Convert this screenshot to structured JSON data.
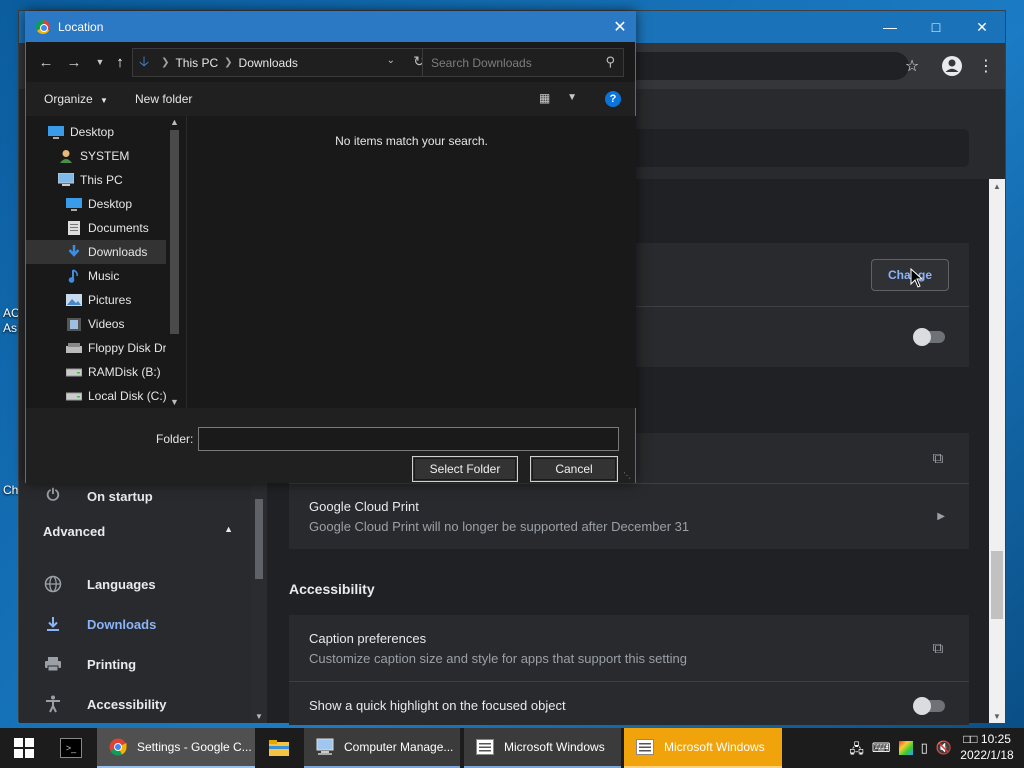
{
  "desktop": {
    "label_1": "AC",
    "label_2": "As",
    "label_3": "Ch"
  },
  "settings": {
    "sidebar": {
      "on_startup": "On startup",
      "advanced": "Advanced",
      "items": [
        {
          "label": "Languages",
          "icon": "globe-icon"
        },
        {
          "label": "Downloads",
          "icon": "download-icon"
        },
        {
          "label": "Printing",
          "icon": "printer-icon"
        },
        {
          "label": "Accessibility",
          "icon": "accessibility-icon"
        }
      ]
    },
    "change_button": "Change",
    "cloud_print_title": "Google Cloud Print",
    "cloud_print_sub": "Google Cloud Print will no longer be supported after December 31",
    "accessibility_heading": "Accessibility",
    "caption_title": "Caption preferences",
    "caption_sub": "Customize caption size and style for apps that support this setting",
    "highlight_title": "Show a quick highlight on the focused object"
  },
  "dialog": {
    "title": "Location",
    "breadcrumb": [
      "This PC",
      "Downloads"
    ],
    "search_placeholder": "Search Downloads",
    "organize": "Organize",
    "new_folder": "New folder",
    "help": "?",
    "empty_message": "No items match your search.",
    "tree": [
      {
        "label": "Desktop",
        "indent": 0,
        "icon": "desktop-icon"
      },
      {
        "label": "SYSTEM",
        "indent": 1,
        "icon": "user-icon"
      },
      {
        "label": "This PC",
        "indent": 1,
        "icon": "computer-icon"
      },
      {
        "label": "Desktop",
        "indent": 2,
        "icon": "desktop-icon"
      },
      {
        "label": "Documents",
        "indent": 2,
        "icon": "documents-icon"
      },
      {
        "label": "Downloads",
        "indent": 2,
        "icon": "downloads-icon",
        "selected": true
      },
      {
        "label": "Music",
        "indent": 2,
        "icon": "music-icon"
      },
      {
        "label": "Pictures",
        "indent": 2,
        "icon": "pictures-icon"
      },
      {
        "label": "Videos",
        "indent": 2,
        "icon": "videos-icon"
      },
      {
        "label": "Floppy Disk Dri",
        "indent": 2,
        "icon": "floppy-icon"
      },
      {
        "label": "RAMDisk (B:)",
        "indent": 2,
        "icon": "drive-icon"
      },
      {
        "label": "Local Disk (C:)",
        "indent": 2,
        "icon": "drive-icon"
      }
    ],
    "folder_label": "Folder:",
    "folder_value": "",
    "select_button": "Select Folder",
    "cancel_button": "Cancel"
  },
  "taskbar": {
    "items": [
      {
        "label": "Settings - Google C...",
        "icon": "chrome-icon",
        "state": "active"
      },
      {
        "label": "",
        "icon": "file-explorer-icon",
        "state": "normal"
      },
      {
        "label": "Computer Manage...",
        "icon": "computer-management-icon",
        "state": "open"
      },
      {
        "label": "Microsoft Windows",
        "icon": "window-list-icon",
        "state": "open"
      },
      {
        "label": "Microsoft Windows",
        "icon": "window-list-icon",
        "state": "flash"
      }
    ],
    "clock_time": "□□ 10:25",
    "clock_date": "2022/1/18"
  },
  "colors": {
    "dialog_accent": "#2b78c4",
    "link_blue": "#8ab4f8",
    "flash_orange": "#f0a30a"
  }
}
